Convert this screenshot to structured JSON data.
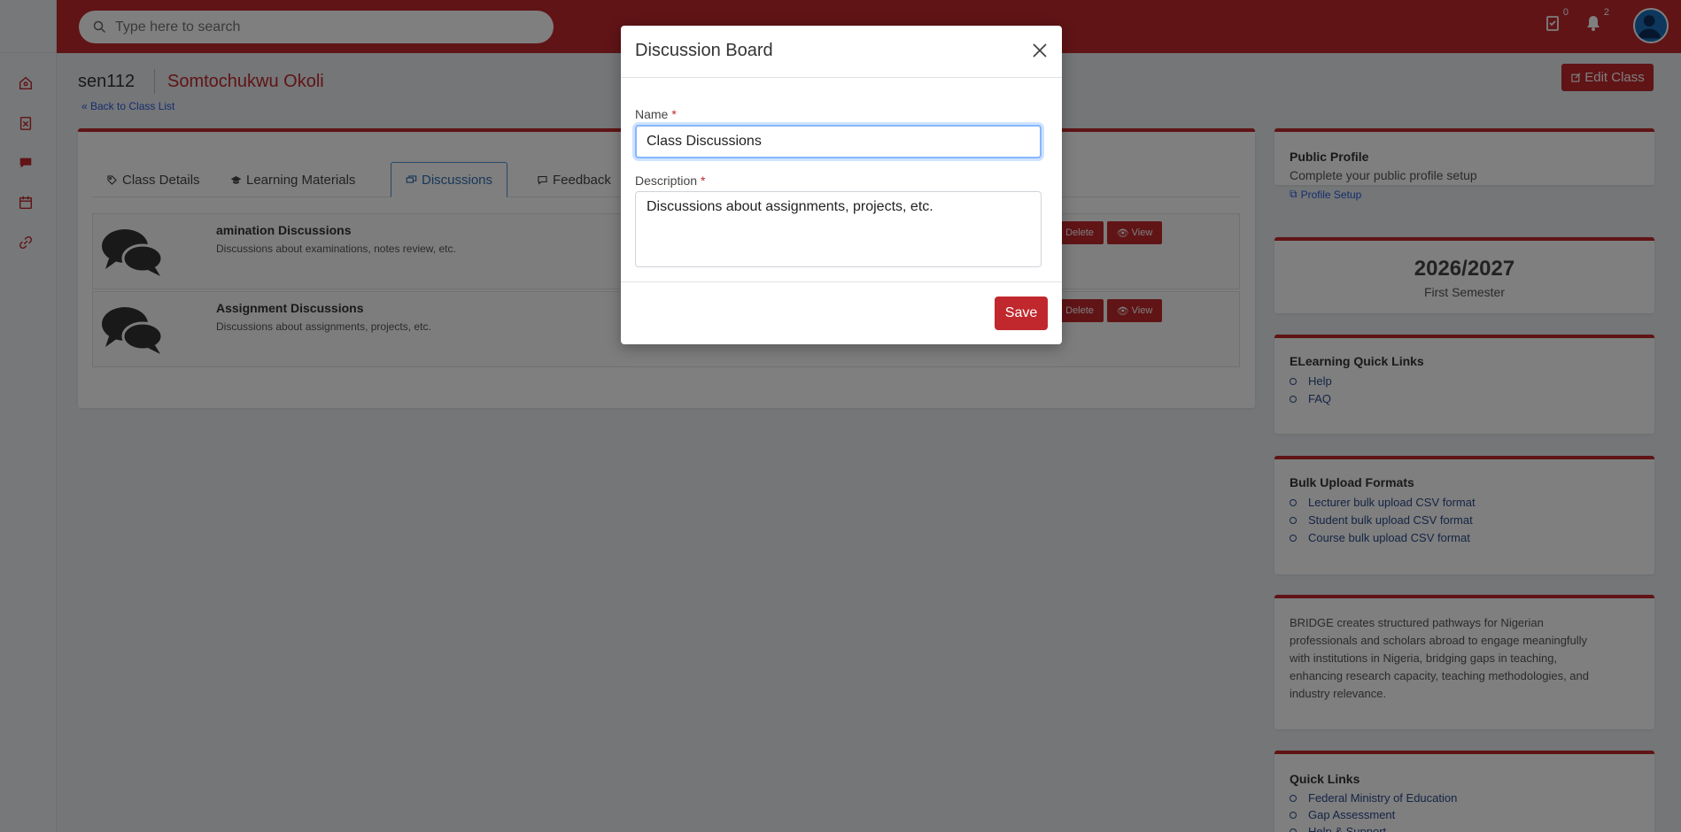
{
  "topbar": {
    "search_placeholder": "Type here to search",
    "tasks_badge": "0",
    "notifications_badge": "2"
  },
  "header": {
    "class_code": "sen112",
    "class_name": "Somtochukwu Okoli",
    "back_link": "« Back to Class List",
    "edit_button": "Edit Class"
  },
  "tabs": [
    {
      "label": "Class Details",
      "icon": "tag-icon"
    },
    {
      "label": "Learning Materials",
      "icon": "graduation-cap-icon"
    },
    {
      "label": "Discussions",
      "icon": "chat-icon",
      "active": true
    },
    {
      "label": "Feedback",
      "icon": "comment-icon"
    }
  ],
  "discussions": [
    {
      "title": "amination Discussions",
      "description": "Discussions about examinations, notes review, etc.",
      "delete": "Delete",
      "view": "View"
    },
    {
      "title": "Assignment Discussions",
      "description": "Discussions about assignments, projects, etc.",
      "delete": "Delete",
      "view": "View"
    }
  ],
  "right": {
    "public_profile": {
      "title": "Public Profile",
      "text": "Complete your public profile setup",
      "link": "Profile Setup"
    },
    "session": {
      "year": "2026/2027",
      "semester": "First Semester"
    },
    "elearning": {
      "title": "ELearning Quick Links",
      "links": [
        "Help",
        "FAQ"
      ]
    },
    "bulk": {
      "title": "Bulk Upload Formats",
      "links": [
        "Lecturer bulk upload CSV format",
        "Student bulk upload CSV format",
        "Course bulk upload CSV format"
      ]
    },
    "bridge": {
      "lines": [
        "BRIDGE creates structured pathways for Nigerian",
        "professionals and scholars abroad to engage meaningfully",
        "with institutions in Nigeria, bridging gaps in teaching,",
        "enhancing research capacity, teaching methodologies, and",
        "industry relevance."
      ]
    },
    "quick": {
      "title": "Quick Links",
      "links": [
        "Federal Ministry of Education",
        "Gap Assessment",
        "Help & Support"
      ]
    }
  },
  "modal": {
    "title": "Discussion Board",
    "name_label": "Name",
    "name_value": "Class Discussions",
    "description_label": "Description",
    "description_value": "Discussions about assignments, projects, etc.",
    "save_button": "Save",
    "required_mark": "*"
  },
  "colors": {
    "brand": "#c0282d",
    "focus": "#86b7fe"
  }
}
